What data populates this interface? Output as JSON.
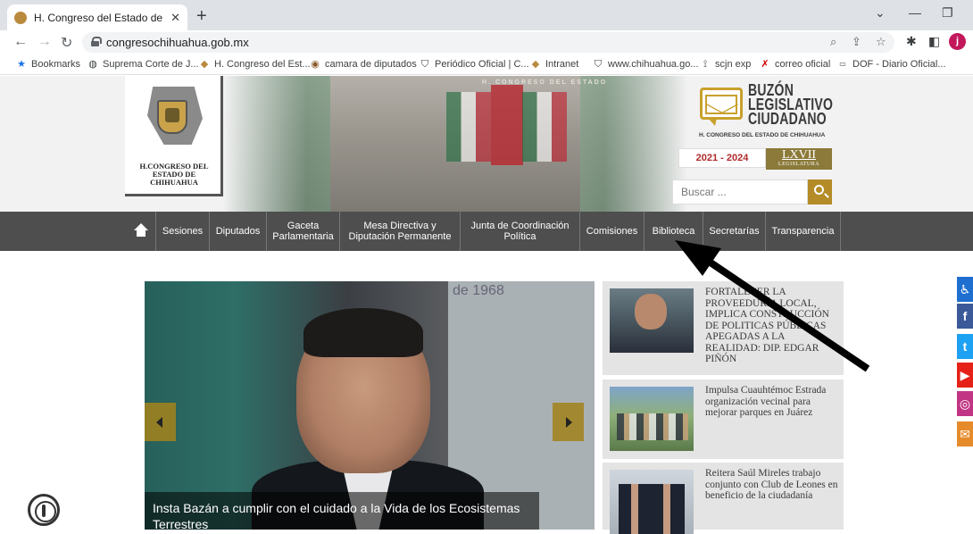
{
  "browser": {
    "tab_title": "H. Congreso del Estado de Chihu",
    "tab_close": "✕",
    "new_tab": "+",
    "window_controls": {
      "minimize": "—",
      "maximize": "❐",
      "collapse": "⌄"
    },
    "url": "congresochihuahua.gob.mx",
    "profile_initial": "j",
    "bookmarks": [
      {
        "label": "Bookmarks",
        "icon": "star-icon",
        "glyph": "★"
      },
      {
        "label": "Suprema Corte de J...",
        "icon": "globe-icon",
        "glyph": "◍"
      },
      {
        "label": "H. Congreso del Est...",
        "icon": "congreso-favicon",
        "glyph": "◆"
      },
      {
        "label": "camara de diputados",
        "icon": "camara-favicon",
        "glyph": "◉"
      },
      {
        "label": "Periódico Oficial | C...",
        "icon": "shield-icon",
        "glyph": "⛉"
      },
      {
        "label": "Intranet",
        "icon": "congreso-favicon",
        "glyph": "◆"
      },
      {
        "label": "www.chihuahua.go...",
        "icon": "shield-icon",
        "glyph": "⛉"
      },
      {
        "label": "scjn exp",
        "icon": "scjn-icon",
        "glyph": "⟟"
      },
      {
        "label": "correo oficial",
        "icon": "x-icon",
        "glyph": "✗"
      },
      {
        "label": "DOF - Diario Oficial...",
        "icon": "dof-icon",
        "glyph": "▭"
      }
    ]
  },
  "header": {
    "logo_text": "H.CONGRESO DEL ESTADO DE CHIHUAHUA",
    "chamber_engraving": "H. CONGRESO DEL ESTADO",
    "buzon_title_lines": [
      "BUZÓN",
      "LEGISLATIVO",
      "CIUDADANO"
    ],
    "buzon_subtitle": "H. CONGRESO DEL ESTADO DE CHIHUAHUA",
    "years": "2021 - 2024",
    "legislature": "LXVII",
    "legislature_label": "LEGISLATURA",
    "search_placeholder": "Buscar ..."
  },
  "menu": [
    "Sesiones",
    "Diputados",
    "Gaceta Parlamentaria",
    "Mesa Directiva y Diputación Permanente",
    "Junta de Coordinación Política",
    "Comisiones",
    "Biblioteca",
    "Secretarías",
    "Transparencia"
  ],
  "slider": {
    "caption": "Insta Bazán a cumplir con el cuidado a la Vida de los Ecosistemas Terrestres",
    "wall_text": "de 1968"
  },
  "news": [
    {
      "title": "FORTALECER LA PROVEEDURÍA LOCAL, IMPLICA CONSTRUCCIÓN DE POLITICAS PÚBLICAS APEGADAS A LA REALIDAD: DIP. EDGAR PIÑÓN"
    },
    {
      "title": "Impulsa Cuauhtémoc Estrada organización vecinal para mejorar parques en Juárez"
    },
    {
      "title": "Reitera Saúl Mireles trabajo conjunto con Club de Leones en beneficio de la ciudadanía"
    }
  ],
  "social": [
    {
      "name": "accessibility",
      "glyph": "♿",
      "color": "#1e6fd0"
    },
    {
      "name": "facebook",
      "glyph": "f",
      "color": "#3b5998"
    },
    {
      "name": "twitter",
      "glyph": "t",
      "color": "#1da1f2"
    },
    {
      "name": "youtube",
      "glyph": "▶",
      "color": "#e62117"
    },
    {
      "name": "instagram",
      "glyph": "◎",
      "color": "#c13584"
    },
    {
      "name": "email",
      "glyph": "✉",
      "color": "#e58b2b"
    }
  ],
  "colors": {
    "menu_bg": "#4e4e4e",
    "gold_accent": "#b48b27",
    "years_red": "#b02a2a"
  }
}
